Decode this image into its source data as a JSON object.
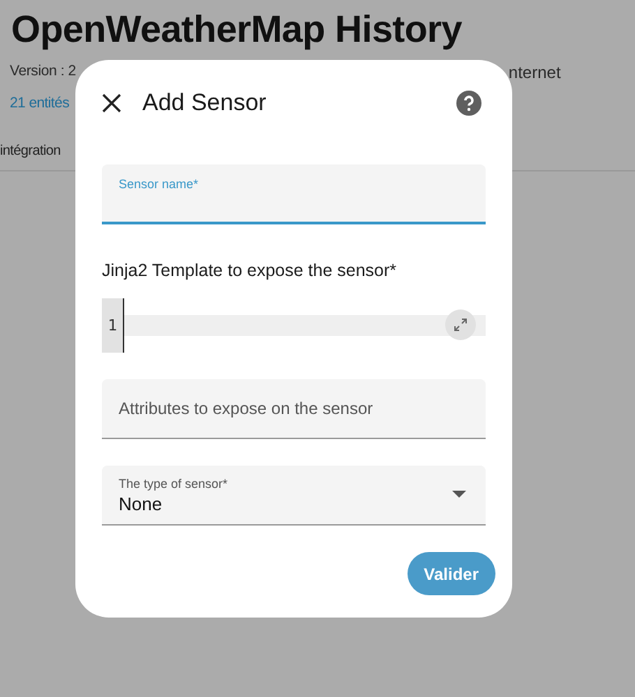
{
  "page": {
    "title": "OpenWeatherMap History",
    "version": "Version : 2",
    "connection": "nternet",
    "entities_link": "21 entités",
    "tab": "intégration"
  },
  "dialog": {
    "title": "Add Sensor",
    "fields": [
      {
        "kind": "text",
        "label": "Sensor name*",
        "focused": true
      },
      {
        "kind": "code",
        "label": "Jinja2 Template to expose the sensor*",
        "line_number": "1"
      },
      {
        "kind": "text",
        "placeholder": "Attributes to expose on the sensor",
        "focused": false
      },
      {
        "kind": "select",
        "label": "The type of sensor*",
        "value": "None"
      }
    ],
    "submit": "Valider"
  }
}
